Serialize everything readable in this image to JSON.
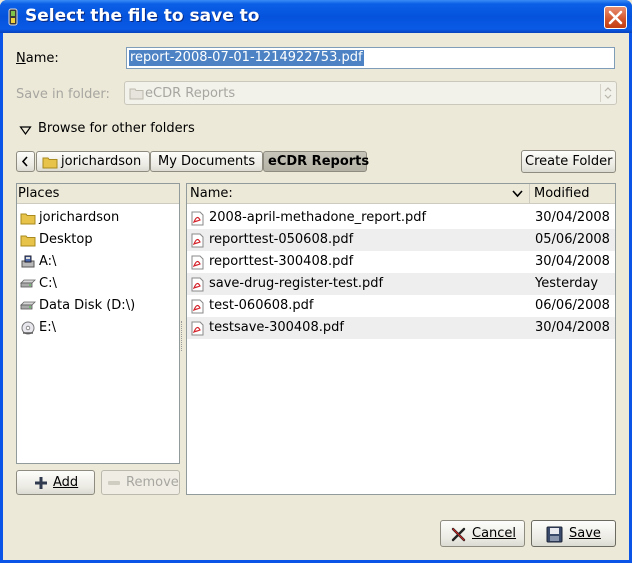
{
  "window": {
    "title": "Select the file to save to"
  },
  "form": {
    "name_label": "Name:",
    "name_value": "report-2008-07-01-1214922753.pdf",
    "folder_label": "Save in folder:",
    "folder_value": "eCDR Reports",
    "browse_label": "Browse for other folders"
  },
  "path_bar": {
    "back_glyph": "‹",
    "crumbs": [
      "jorichardson",
      "My Documents",
      "eCDR Reports"
    ],
    "create_folder_label": "Create Folder"
  },
  "places": {
    "header": "Places",
    "items": [
      {
        "label": "jorichardson",
        "icon": "folder-icon"
      },
      {
        "label": "Desktop",
        "icon": "folder-icon"
      },
      {
        "label": "A:\\",
        "icon": "floppy-drive-icon"
      },
      {
        "label": "C:\\",
        "icon": "hard-drive-icon"
      },
      {
        "label": "Data Disk (D:\\)",
        "icon": "hard-drive-icon"
      },
      {
        "label": "E:\\",
        "icon": "cd-drive-icon"
      }
    ],
    "add_label": "Add",
    "remove_label": "Remove"
  },
  "files": {
    "col_name": "Name:",
    "col_modified": "Modified",
    "rows": [
      {
        "name": "2008-april-methadone_report.pdf",
        "modified": "30/04/2008"
      },
      {
        "name": "reporttest-050608.pdf",
        "modified": "05/06/2008"
      },
      {
        "name": "reporttest-300408.pdf",
        "modified": "30/04/2008"
      },
      {
        "name": "save-drug-register-test.pdf",
        "modified": "Yesterday"
      },
      {
        "name": "test-060608.pdf",
        "modified": "06/06/2008"
      },
      {
        "name": "testsave-300408.pdf",
        "modified": "30/04/2008"
      }
    ]
  },
  "actions": {
    "cancel_label": "Cancel",
    "save_label": "Save"
  },
  "colors": {
    "titlebar": "#0553dd",
    "selection": "#4d83c4",
    "folder": "#e8c34a",
    "pdf_red": "#d4232b"
  }
}
